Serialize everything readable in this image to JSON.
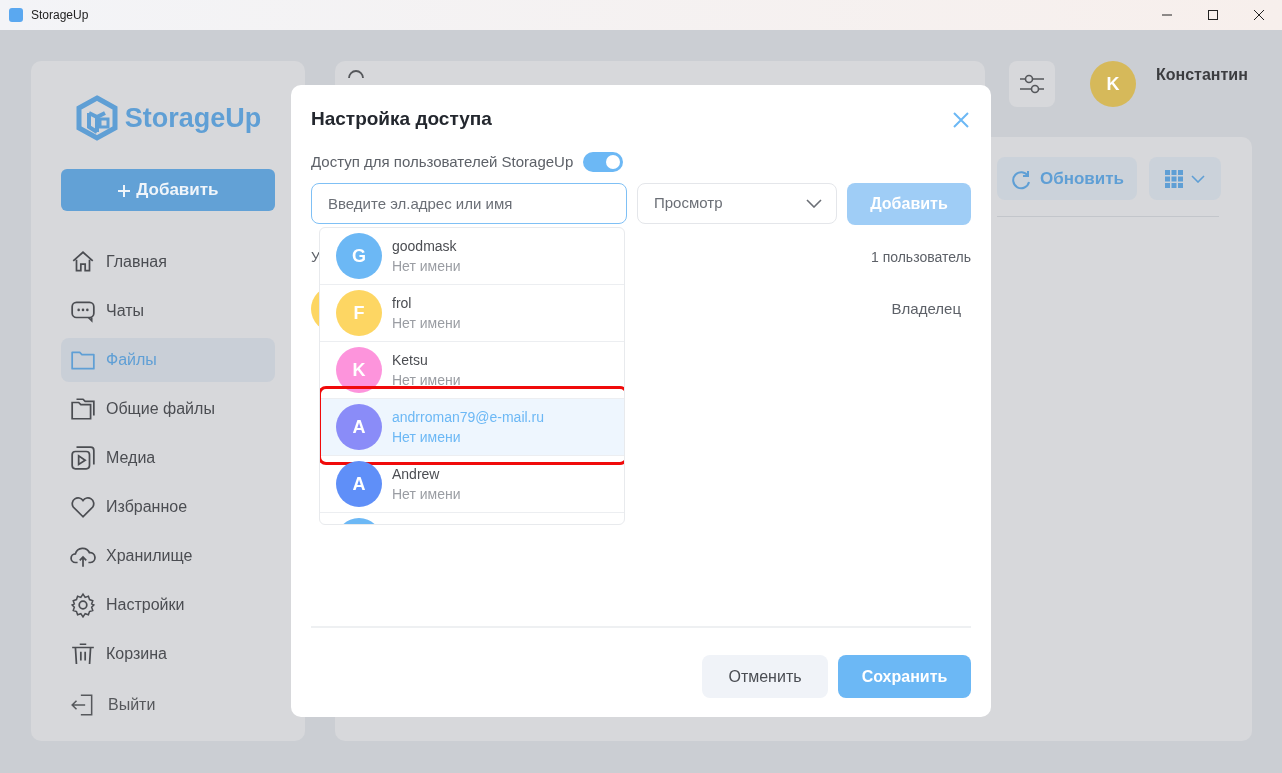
{
  "window": {
    "title": "StorageUp"
  },
  "sidebar": {
    "logo": "StorageUp",
    "add_button": "Добавить",
    "items": [
      {
        "kind": "home",
        "label": "Главная",
        "selected": false
      },
      {
        "kind": "chat",
        "label": "Чаты",
        "selected": false
      },
      {
        "kind": "folder",
        "label": "Файлы",
        "selected": true
      },
      {
        "kind": "shared",
        "label": "Общие файлы",
        "selected": false
      },
      {
        "kind": "media",
        "label": "Медиа",
        "selected": false
      },
      {
        "kind": "heart",
        "label": "Избранное",
        "selected": false
      },
      {
        "kind": "cloud",
        "label": "Хранилище",
        "selected": false
      },
      {
        "kind": "gear",
        "label": "Настройки",
        "selected": false
      },
      {
        "kind": "trash",
        "label": "Корзина",
        "selected": false
      }
    ],
    "logout": "Выйти"
  },
  "user": {
    "initial": "K",
    "name": "Константин",
    "color": "#d6b95a"
  },
  "toolbar": {
    "refresh": "Обновить"
  },
  "dialog": {
    "title": "Настройка доступа",
    "toggle_label": "Доступ для пользователей StorageUp",
    "toggle_on": true,
    "input": {
      "placeholder": "Введите эл.адрес или имя"
    },
    "role": "Просмотр",
    "add_button": "Добавить",
    "section_label": "У",
    "count": "1 пользователь",
    "owner_role": "Владелец",
    "suggestions": [
      {
        "initial": "G",
        "login": "goodmask",
        "name": "Нет имени",
        "color": "#6cb8f5",
        "selected": false
      },
      {
        "initial": "F",
        "login": "frol",
        "name": "Нет имени",
        "color": "#fdd663",
        "selected": false
      },
      {
        "initial": "K",
        "login": "Ketsu",
        "name": "Нет имени",
        "color": "#fd94dc",
        "selected": false
      },
      {
        "initial": "A",
        "login": "andrroman79@e-mail.ru",
        "name": "Нет имени",
        "color": "#8a8cf8",
        "selected": true
      },
      {
        "initial": "A",
        "login": "Andrew",
        "name": "Нет имени",
        "color": "#5f8ff8",
        "selected": false
      },
      {
        "color": "#6cb8f5",
        "selected": false
      }
    ],
    "cancel": "Отменить",
    "save": "Сохранить"
  }
}
